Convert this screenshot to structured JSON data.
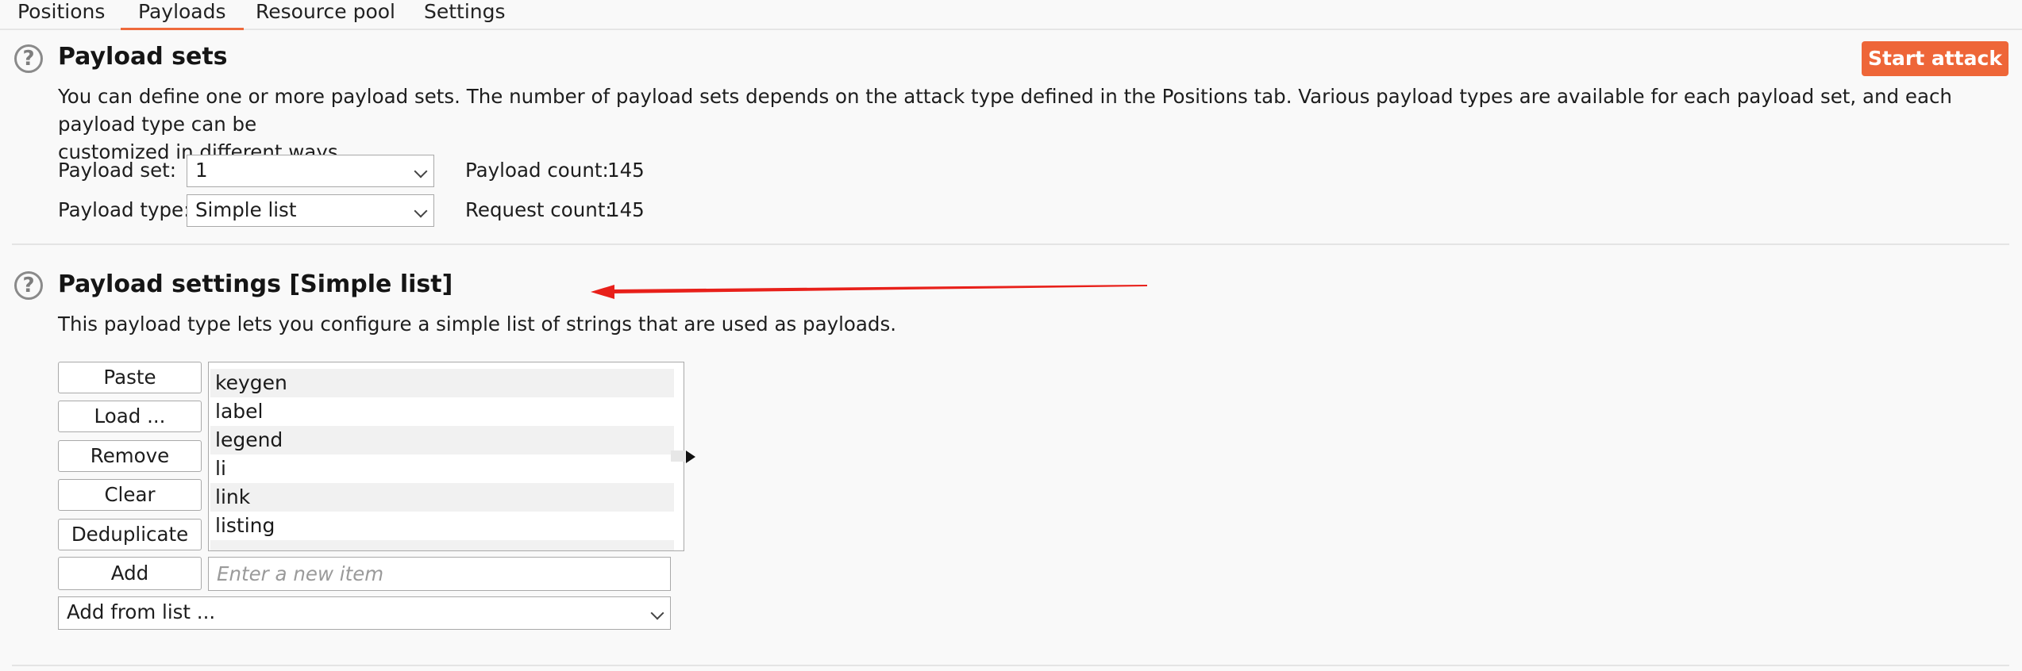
{
  "tabs": [
    {
      "label": "Positions"
    },
    {
      "label": "Payloads",
      "active": true
    },
    {
      "label": "Resource pool"
    },
    {
      "label": "Settings"
    }
  ],
  "payload_sets": {
    "help_glyph": "?",
    "title": "Payload sets",
    "start_attack": "Start attack",
    "description_line1": "You can define one or more payload sets. The number of payload sets depends on the attack type defined in the Positions tab. Various payload types are available for each payload set, and each payload type can be",
    "description_line2": "customized in different ways.",
    "set_label": "Payload set:",
    "set_value": "1",
    "type_label": "Payload type:",
    "type_value": "Simple list",
    "payload_count_label": "Payload count:",
    "payload_count_value": "145",
    "request_count_label": "Request count:",
    "request_count_value": "145"
  },
  "payload_settings": {
    "help_glyph": "?",
    "title": "Payload settings [Simple list]",
    "description": "This payload type lets you configure a simple list of strings that are used as payloads.",
    "buttons": {
      "paste": "Paste",
      "load": "Load ...",
      "remove": "Remove",
      "clear": "Clear",
      "deduplicate": "Deduplicate",
      "add": "Add"
    },
    "list_items": [
      "keygen",
      "label",
      "legend",
      "li",
      "link",
      "listing"
    ],
    "new_item_placeholder": "Enter a new item",
    "add_from_list": "Add from list ..."
  },
  "colors": {
    "accent": "#ee6638",
    "arrow": "#e8201a"
  }
}
